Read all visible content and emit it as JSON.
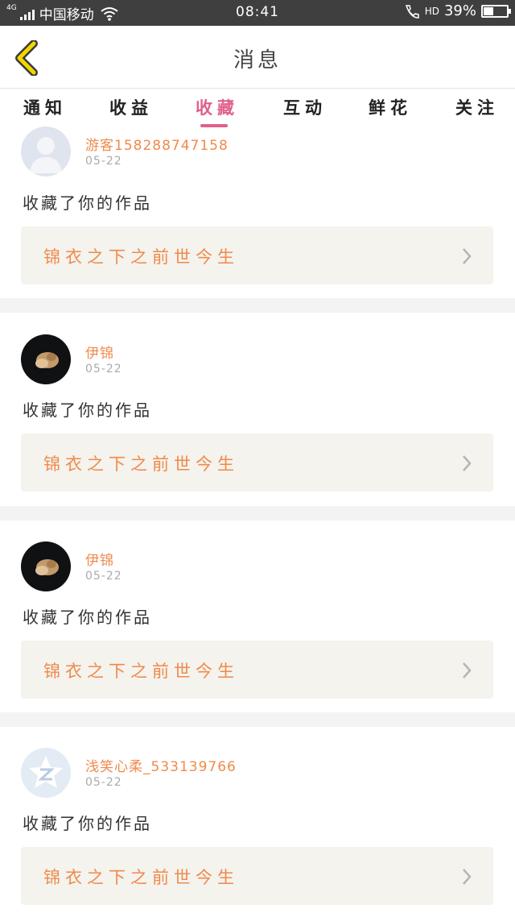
{
  "status_bar": {
    "network": "4G",
    "carrier": "中国移动",
    "time": "08:41",
    "hd": "HD",
    "battery_percent": "39%",
    "battery_level": 0.39,
    "icons": [
      "signal-icon",
      "wifi-icon",
      "call-hd-icon",
      "battery-icon"
    ]
  },
  "header": {
    "title": "消息",
    "back_icon": "chevron-left-icon"
  },
  "tabs": [
    {
      "label": "通知"
    },
    {
      "label": "收益"
    },
    {
      "label": "收藏",
      "active": true
    },
    {
      "label": "互动"
    },
    {
      "label": "鲜花"
    },
    {
      "label": "关注"
    }
  ],
  "feed": [
    {
      "username": "游客158288747158",
      "date": "05-22",
      "action": "收藏了你的作品",
      "work_title": "锦衣之下之前世今生",
      "avatar": "default-avatar-icon"
    },
    {
      "username": "伊锦",
      "date": "05-22",
      "action": "收藏了你的作品",
      "work_title": "锦衣之下之前世今生",
      "avatar": "photo-avatar"
    },
    {
      "username": "伊锦",
      "date": "05-22",
      "action": "收藏了你的作品",
      "work_title": "锦衣之下之前世今生",
      "avatar": "photo-avatar"
    },
    {
      "username": "浅笑心柔_533139766",
      "date": "05-22",
      "action": "收藏了你的作品",
      "work_title": "锦衣之下之前世今生",
      "avatar": "qzone-avatar-icon"
    }
  ],
  "colors": {
    "accent_pink": "#e0608b",
    "accent_orange": "#f08a4b",
    "back_arrow_yellow": "#f5d500",
    "status_bar_bg": "#3f3f3f"
  }
}
